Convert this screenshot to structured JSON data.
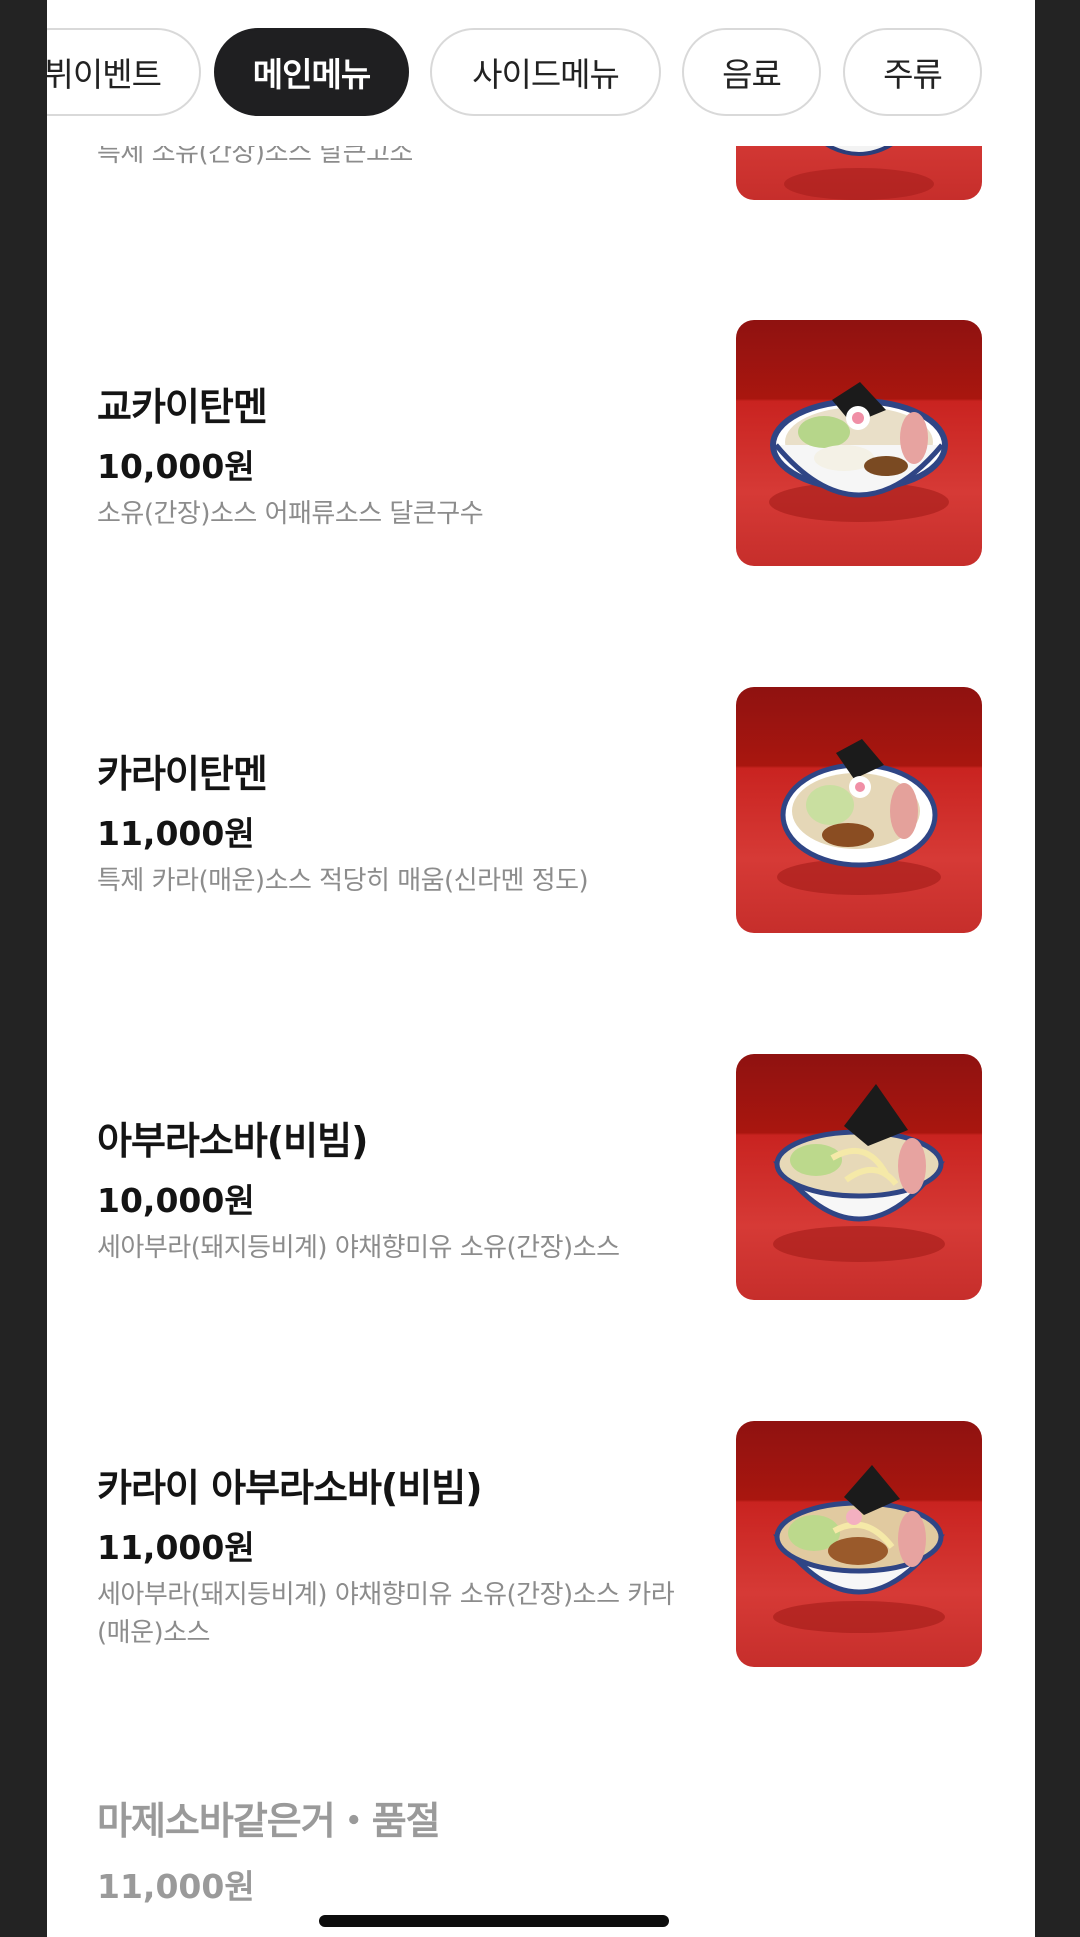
{
  "tabs": [
    {
      "label": "뷔이벤트",
      "active": false
    },
    {
      "label": "메인메뉴",
      "active": true
    },
    {
      "label": "사이드메뉴",
      "active": false
    },
    {
      "label": "음료",
      "active": false
    },
    {
      "label": "주류",
      "active": false
    }
  ],
  "partial_item": {
    "desc": "특제 소유(간장)소스 달큰고소"
  },
  "items": [
    {
      "name": "교카이탄멘",
      "price": "10,000원",
      "desc": "소유(간장)소스 어패류소스 달큰구수"
    },
    {
      "name": "카라이탄멘",
      "price": "11,000원",
      "desc": "특제 카라(매운)소스 적당히 매움(신라멘 정도)"
    },
    {
      "name": "아부라소바(비빔)",
      "price": "10,000원",
      "desc": "세아부라(돼지등비계) 야채향미유 소유(간장)소스"
    },
    {
      "name": "카라이 아부라소바(비빔)",
      "price": "11,000원",
      "desc": "세아부라(돼지등비계) 야채향미유 소유(간장)소스 카라(매운)소스"
    },
    {
      "name": "마제소바같은거・품절",
      "price": "11,000원",
      "desc": ""
    }
  ],
  "colors": {
    "active_tab_bg": "#1f1f21",
    "price_text": "#141414",
    "desc_text": "#8c8c8c",
    "thumb_red": "#c92320"
  }
}
